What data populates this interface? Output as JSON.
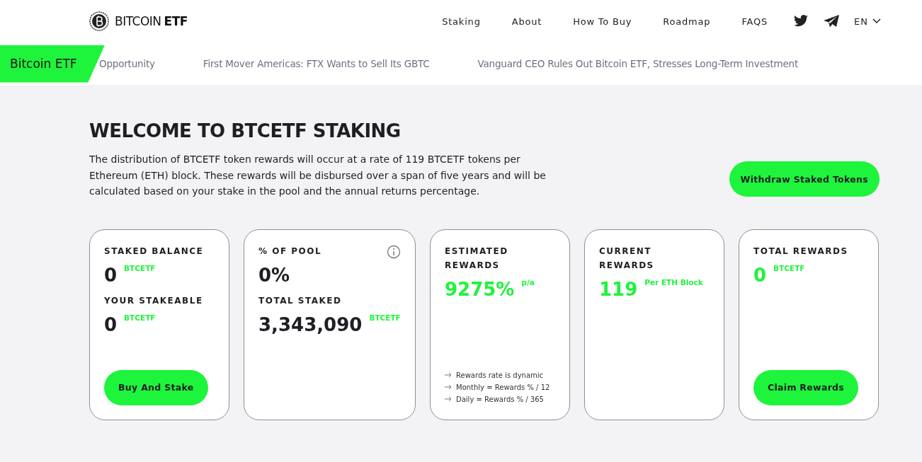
{
  "header": {
    "logo": {
      "light": "BITCOIN",
      "bold": "ETF"
    },
    "nav": [
      "Staking",
      "About",
      "How To Buy",
      "Roadmap",
      "FAQS"
    ],
    "language": "EN"
  },
  "ticker": {
    "badge": "Bitcoin ETF",
    "items": [
      "Opportunity",
      "First Mover Americas: FTX Wants to Sell Its GBTC",
      "Vanguard CEO Rules Out Bitcoin ETF, Stresses Long-Term Investment"
    ]
  },
  "title": "WELCOME TO BTCETF STAKING",
  "description": "The distribution of BTCETF token rewards will occur at a rate of 119 BTCETF tokens per Ethereum (ETH) block. These rewards will be disbursed over a span of five years and will be calculated based on your stake in the pool and the annual returns percentage.",
  "withdraw_button": "Withdraw Staked Tokens",
  "cards": [
    {
      "info": false,
      "blocks": [
        {
          "kind": "label",
          "text": "STAKED BALANCE"
        },
        {
          "kind": "value",
          "value": "0",
          "unit": "BTCETF",
          "highlight": false
        },
        {
          "kind": "label",
          "text": "YOUR STAKEABLE"
        },
        {
          "kind": "value",
          "value": "0",
          "unit": "BTCETF",
          "highlight": false
        },
        {
          "kind": "button",
          "text": "Buy And Stake"
        }
      ]
    },
    {
      "info": true,
      "blocks": [
        {
          "kind": "label",
          "text": "% OF POOL"
        },
        {
          "kind": "value",
          "value": "0%",
          "highlight": false
        },
        {
          "kind": "label",
          "text": "TOTAL STAKED"
        },
        {
          "kind": "value",
          "value": "3,343,090",
          "unit": "BTCETF",
          "highlight": false
        }
      ]
    },
    {
      "info": false,
      "blocks": [
        {
          "kind": "label",
          "text": "ESTIMATED REWARDS"
        },
        {
          "kind": "value",
          "value": "9275%",
          "unit": "p/a",
          "highlight": true
        },
        {
          "kind": "notes",
          "items": [
            "Rewards rate is dynamic",
            "Monthly = Rewards % / 12",
            "Daily = Rewards % / 365"
          ]
        }
      ]
    },
    {
      "info": false,
      "blocks": [
        {
          "kind": "label",
          "text": "CURRENT REWARDS"
        },
        {
          "kind": "value",
          "value": "119",
          "unit": "Per ETH Block",
          "highlight": true
        }
      ]
    },
    {
      "info": false,
      "blocks": [
        {
          "kind": "label",
          "text": "TOTAL REWARDS"
        },
        {
          "kind": "value",
          "value": "0",
          "unit": "BTCETF",
          "highlight": true
        },
        {
          "kind": "button",
          "text": "Claim Rewards"
        }
      ]
    }
  ]
}
